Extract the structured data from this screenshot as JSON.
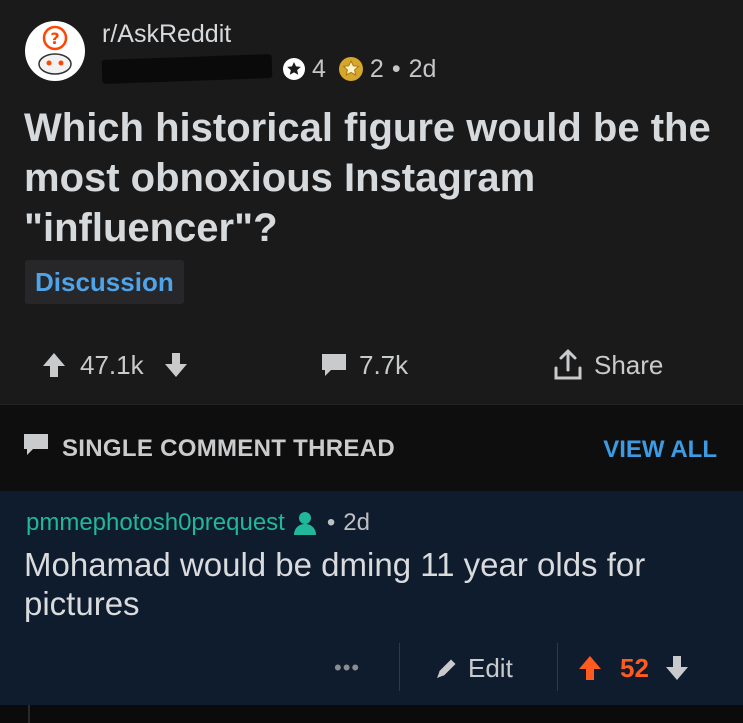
{
  "post": {
    "subreddit": "r/AskReddit",
    "author_redacted": true,
    "karma_badge_icon": "star-badge-icon",
    "karma_count": "4",
    "award_icon": "gold-award-icon",
    "award_count": "2",
    "separator": "•",
    "age": "2d",
    "title": "Which historical figure would be the most obnoxious Instagram \"influencer\"?",
    "flair": "Discussion",
    "upvotes": "47.1k",
    "comments": "7.7k",
    "share_label": "Share"
  },
  "thread_banner": {
    "label": "SINGLE COMMENT THREAD",
    "view_all": "VIEW ALL"
  },
  "comment": {
    "author": "pmmephotosh0prequest",
    "author_icon": "op-user-icon",
    "separator": "•",
    "age": "2d",
    "body": "Mohamad would be dming 11 year olds for pictures",
    "more": "•••",
    "edit_label": "Edit",
    "score": "52"
  },
  "colors": {
    "background": "#0b0b0c",
    "post_bg": "#1a1a1b",
    "comment_bg": "#0f1c2e",
    "accent_blue": "#3d9be3",
    "author_teal": "#21b79b",
    "upvote_orange": "#ff5a1f"
  }
}
